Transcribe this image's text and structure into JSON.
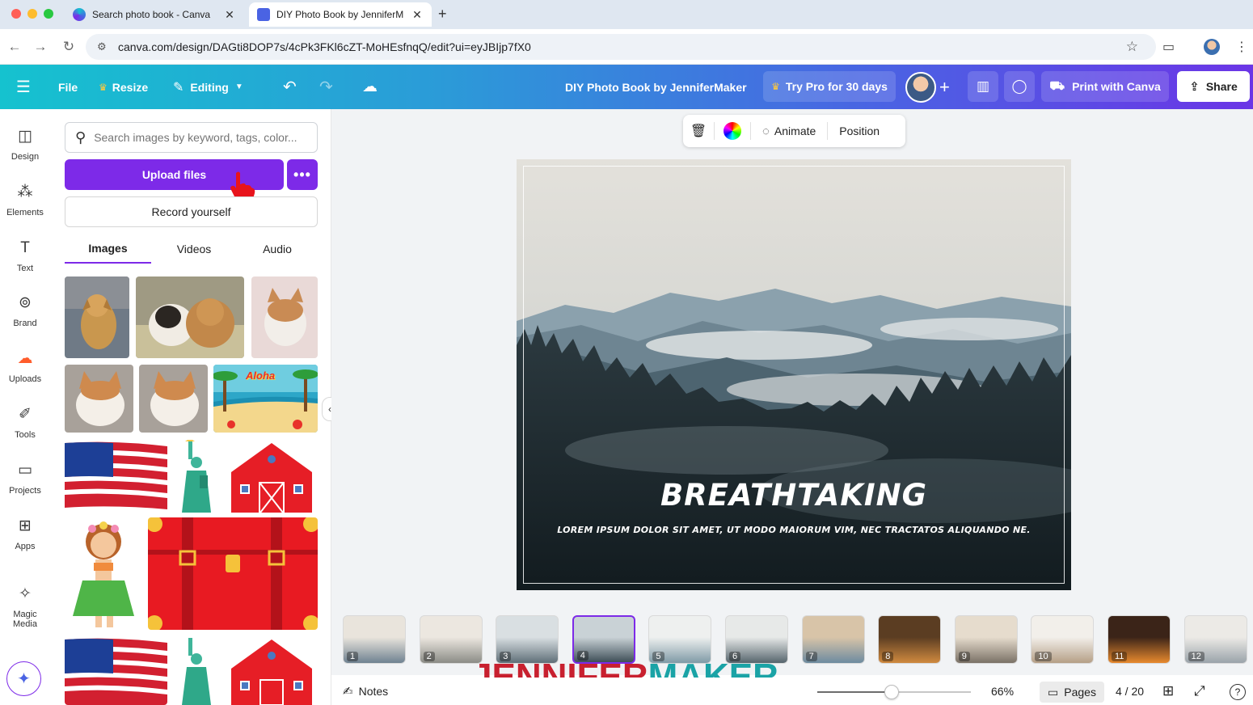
{
  "browser": {
    "tabs": [
      {
        "title": "Search photo book - Canva",
        "active": false
      },
      {
        "title": "DIY Photo Book by JenniferM",
        "active": true
      }
    ],
    "url": "canva.com/design/DAGti8DOP7s/4cPk3FKl6cZT-MoHEsfnqQ/edit?ui=eyJBIjp7fX0"
  },
  "topbar": {
    "file": "File",
    "resize": "Resize",
    "editing": "Editing",
    "design_title": "DIY Photo Book by JenniferMaker",
    "try_pro": "Try Pro for 30 days",
    "print": "Print with Canva",
    "share": "Share"
  },
  "rail": [
    {
      "label": "Design",
      "icon": "design-icon"
    },
    {
      "label": "Elements",
      "icon": "elements-icon"
    },
    {
      "label": "Text",
      "icon": "text-icon"
    },
    {
      "label": "Brand",
      "icon": "brand-icon"
    },
    {
      "label": "Uploads",
      "icon": "uploads-icon"
    },
    {
      "label": "Tools",
      "icon": "tools-icon"
    },
    {
      "label": "Projects",
      "icon": "projects-icon"
    },
    {
      "label": "Apps",
      "icon": "apps-icon"
    },
    {
      "label": "Magic Media",
      "icon": "magic-media-icon"
    }
  ],
  "panel": {
    "search_placeholder": "Search images by keyword, tags, color...",
    "upload": "Upload files",
    "record": "Record yourself",
    "tabs": [
      "Images",
      "Videos",
      "Audio"
    ],
    "thumbnails": [
      "dog",
      "two dogs",
      "cat",
      "kitten",
      "kitten",
      "Aloha beach sticker",
      "american flag",
      "statue of liberty",
      "red barn",
      "hula girl",
      "red suitcase",
      "american flag",
      "statue of liberty",
      "red barn"
    ],
    "aloha_text": "Aloha"
  },
  "context_toolbar": {
    "animate": "Animate",
    "position": "Position"
  },
  "page": {
    "title": "BREATHTAKING",
    "subtitle": "LOREM IPSUM DOLOR SIT AMET, UT MODO MAIORUM VIM, NEC TRACTATOS ALIQUANDO NE."
  },
  "page_strip": [
    "1",
    "2",
    "3",
    "4",
    "5",
    "6",
    "7",
    "8",
    "9",
    "10",
    "11",
    "12"
  ],
  "active_page": 4,
  "bottombar": {
    "notes": "Notes",
    "zoom": "66%",
    "zoom_level": 0.48,
    "pages": "Pages",
    "page_count": "4 / 20",
    "help": "?"
  },
  "watermark": {
    "part1": "JENNIFER",
    "part2": "MAKER"
  },
  "colors": {
    "accent": "#7d2ae8",
    "gradient_start": "#15c2cf",
    "gradient_end": "#6b35e6",
    "upload_icon": "#ff5c2b",
    "watermark_red": "#c8202f",
    "watermark_teal": "#1aa3a6"
  }
}
